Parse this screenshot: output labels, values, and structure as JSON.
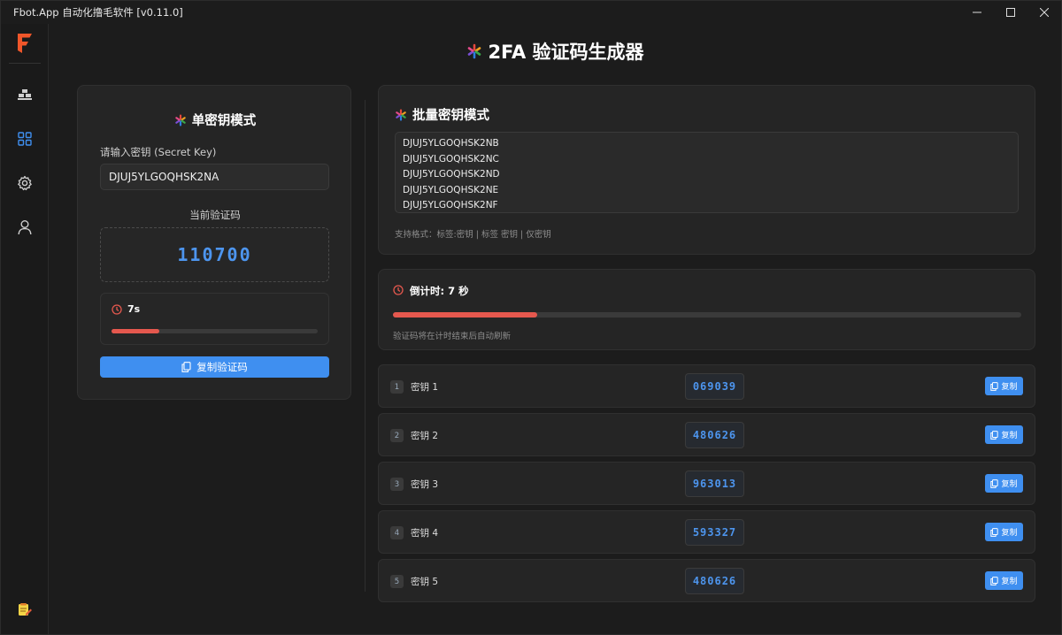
{
  "window": {
    "title": "Fbot.App 自动化撸毛软件 [v0.11.0]"
  },
  "page": {
    "title": "2FA 验证码生成器"
  },
  "single": {
    "title": "单密钥模式",
    "input_label": "请输入密钥 (Secret Key)",
    "secret": "DJUJ5YLGOQHSK2NA",
    "code_label": "当前验证码",
    "code": "110700",
    "timer_text": "7s",
    "progress": 0.23,
    "copy_label": "复制验证码"
  },
  "batch": {
    "title": "批量密钥模式",
    "keys": [
      "DJUJ5YLGOQHSK2NB",
      "DJUJ5YLGOQHSK2NC",
      "DJUJ5YLGOQHSK2ND",
      "DJUJ5YLGOQHSK2NE",
      "DJUJ5YLGOQHSK2NF"
    ],
    "format_hint": "支持格式：标签:密钥 | 标签 密钥 | 仅密钥",
    "countdown_label": "倒计时: 7 秒",
    "countdown_hint": "验证码将在计时结束后自动刷新",
    "progress": 0.23
  },
  "results": [
    {
      "index": "1",
      "name": "密钥 1",
      "code": "069039",
      "copy_label": "复制"
    },
    {
      "index": "2",
      "name": "密钥 2",
      "code": "480626",
      "copy_label": "复制"
    },
    {
      "index": "3",
      "name": "密钥 3",
      "code": "963013",
      "copy_label": "复制"
    },
    {
      "index": "4",
      "name": "密钥 4",
      "code": "593327",
      "copy_label": "复制"
    },
    {
      "index": "5",
      "name": "密钥 5",
      "code": "480626",
      "copy_label": "复制"
    }
  ],
  "colors": {
    "accent": "#3f8ff0",
    "code": "#4d95ee",
    "progress": "#e5584e",
    "logo": "#f0562a"
  },
  "icons": {
    "nav": [
      "stack-icon",
      "grid-icon",
      "gear-icon",
      "user-icon"
    ],
    "bottom": "notepad-icon"
  }
}
